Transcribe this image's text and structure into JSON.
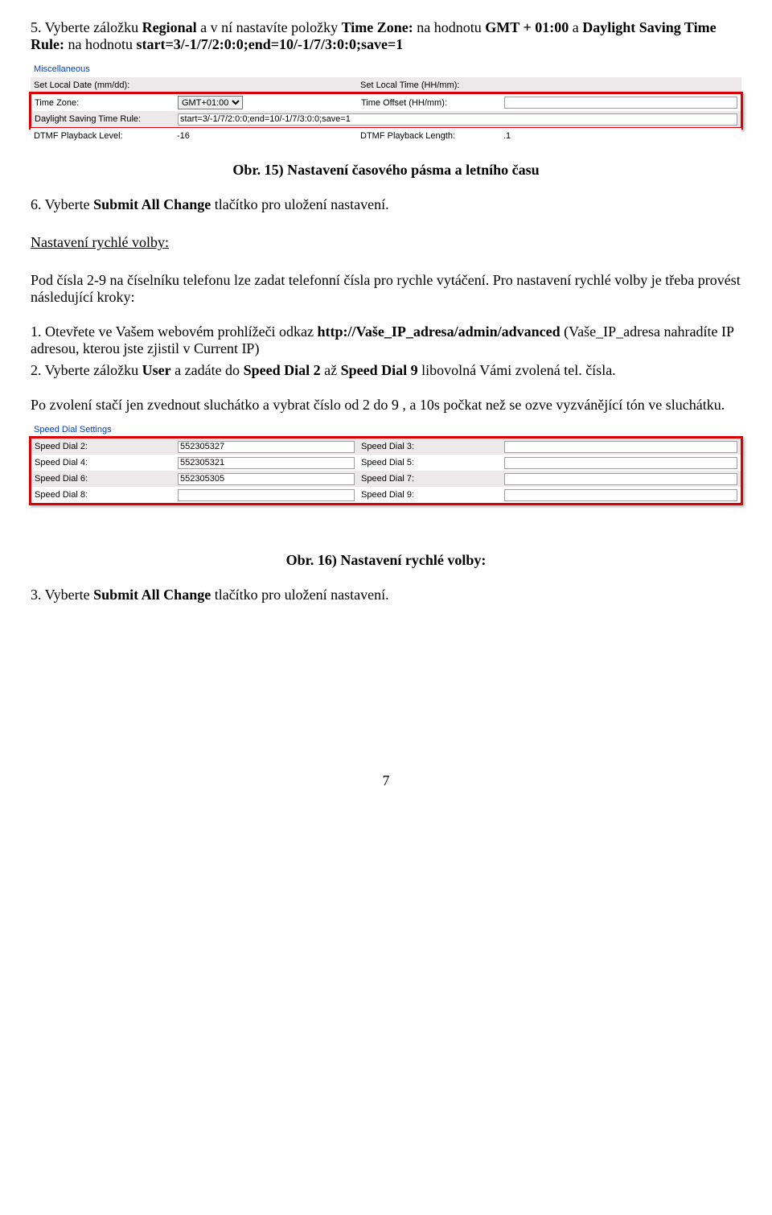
{
  "para_step5_a": "5. Vyberte záložku ",
  "para_step5_b": "Regional",
  "para_step5_c": " a v ní nastavíte položky ",
  "para_step5_d": "Time Zone:",
  "para_step5_e": " na hodnotu ",
  "para_step5_f": "GMT + 01:00",
  "para_step5_g": " a ",
  "para_step5_h": "Daylight Saving Time Rule:",
  "para_step5_i": " na hodnotu ",
  "para_step5_j": "start=3/-1/7/2:0:0;end=10/-1/7/3:0:0;save=1",
  "misc": {
    "header": "Miscellaneous",
    "r1c1": "Set Local Date (mm/dd):",
    "r1c3": "Set Local Time (HH/mm):",
    "r2c1": "Time Zone:",
    "r2sel": "GMT+01:00",
    "r2c3": "Time Offset (HH/mm):",
    "r3c1": "Daylight Saving Time Rule:",
    "r3val": "start=3/-1/7/2:0:0;end=10/-1/7/3:0:0;save=1",
    "r4c1": "DTMF Playback Level:",
    "r4v": "-16",
    "r4c3": "DTMF Playback Length:",
    "r4v2": ".1"
  },
  "fig15": "Obr. 15) Nastavení časového pásma a letního času",
  "step6_a": "6. Vyberte ",
  "step6_b": "Submit All Change",
  "step6_c": " tlačítko pro uložení nastavení.",
  "speedHeading": "Nastavení rychlé volby:",
  "speedIntro": "Pod čísla 2-9 na číselníku telefonu lze zadat telefonní čísla pro rychle vytáčení.  Pro nastavení rychlé volby je třeba provést následující kroky:",
  "s1_a": "1. Otevřete ve Vašem webovém prohlížeči odkaz ",
  "s1_b": "http://Vaše_IP_adresa/admin/advanced",
  "s1_c": " (Vaše_IP_adresa nahradíte IP adresou, kterou jste zjistil v Current IP)",
  "s2_a": "2. Vyberte záložku ",
  "s2_b": "User",
  "s2_c": " a zadáte do ",
  "s2_d": "Speed Dial 2",
  "s2_e": " až ",
  "s2_f": "Speed Dial 9",
  "s2_g": " libovolná Vámi zvolená tel. čísla.",
  "afterPara": "Po zvolení stačí jen zvednout sluchátko a vybrat číslo od 2 do 9 , a 10s počkat než se ozve vyzvánějící tón ve sluchátku.",
  "sdset": {
    "header": "Speed Dial Settings",
    "l2": "Speed Dial 2:",
    "v2": "552305327",
    "l3": "Speed Dial 3:",
    "l4": "Speed Dial 4:",
    "v4": "552305321",
    "l5": "Speed Dial 5:",
    "l6": "Speed Dial 6:",
    "v6": "552305305",
    "l7": "Speed Dial 7:",
    "l8": "Speed Dial 8:",
    "l9": "Speed Dial 9:"
  },
  "fig16": "Obr. 16) Nastavení rychlé volby:",
  "step3_a": "3. Vyberte ",
  "step3_b": "Submit All Change",
  "step3_c": " tlačítko pro uložení nastavení.",
  "page": "7"
}
